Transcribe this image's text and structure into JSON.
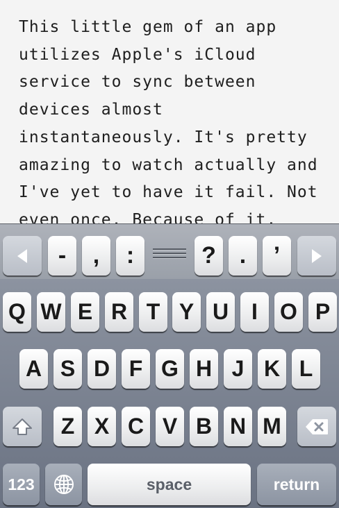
{
  "editor": {
    "lines": [
      "This little gem of an app",
      "utilizes Apple's iCloud",
      "service to sync between",
      "devices almost",
      "instantaneously. It's pretty",
      "amazing to watch actually and",
      "I've yet to have it fail. Not",
      "even once. Because of it,"
    ]
  },
  "extra_keys": {
    "left_arrow": "left-arrow-icon",
    "dash": "-",
    "comma": ",",
    "colon": ":",
    "grip": "drag-handle-icon",
    "question": "?",
    "period": ".",
    "apostrophe": "’",
    "right_arrow": "right-arrow-icon"
  },
  "keyboard": {
    "row1": [
      "Q",
      "W",
      "E",
      "R",
      "T",
      "Y",
      "U",
      "I",
      "O",
      "P"
    ],
    "row2": [
      "A",
      "S",
      "D",
      "F",
      "G",
      "H",
      "J",
      "K",
      "L"
    ],
    "row3": [
      "Z",
      "X",
      "C",
      "V",
      "B",
      "N",
      "M"
    ],
    "shift_icon": "shift-icon",
    "delete_icon": "delete-icon",
    "numbers_label": "123",
    "globe_icon": "globe-icon",
    "space_label": "space",
    "return_label": "return"
  }
}
